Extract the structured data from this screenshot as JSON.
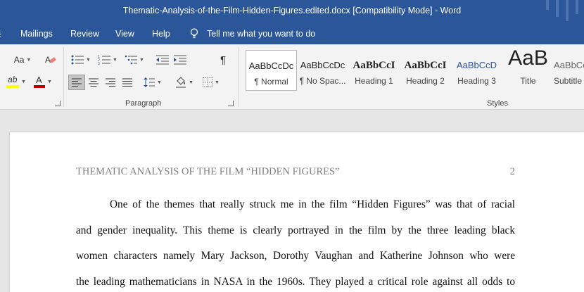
{
  "window": {
    "title": "Thematic-Analysis-of-the-Film-Hidden-Figures.edited.docx [Compatibility Mode]  -  Word"
  },
  "tabs": [
    "Mailings",
    "Review",
    "View",
    "Help"
  ],
  "tell_me": "Tell me what you want to do",
  "ribbon": {
    "font_group": {
      "change_case_label": "Aa",
      "clear_format_icon": "eraser-icon",
      "highlight_label": "ab",
      "font_color_label": "A",
      "highlight_color": "#ffff00",
      "font_color": "#c00000"
    },
    "paragraph_group": {
      "label": "Paragraph",
      "show_marks_label": "¶"
    },
    "styles_group": {
      "label": "Styles",
      "items": [
        {
          "sample": "AaBbCcDc",
          "name": "¶ Normal"
        },
        {
          "sample": "AaBbCcDc",
          "name": "¶ No Spac..."
        },
        {
          "sample": "AaBbCcI",
          "name": "Heading 1"
        },
        {
          "sample": "AaBbCcI",
          "name": "Heading 2"
        },
        {
          "sample": "AaBbCcD",
          "name": "Heading 3"
        },
        {
          "sample": "AaB",
          "name": "Title"
        },
        {
          "sample": "AaBbCcI",
          "name": "Subtitle"
        }
      ]
    }
  },
  "document": {
    "running_head": "THEMATIC ANALYSIS OF THE FILM “HIDDEN FIGURES”",
    "page_number": "2",
    "lines": [
      "One of the themes that really struck me in the film “Hidden Figures” was that of racial",
      "and gender inequality. This theme is clearly portrayed in the film by the three leading black",
      "women characters namely Mary Jackson, Dorothy Vaughan and Katherine Johnson who were",
      "the leading mathematicians in NASA in the 1960s. They played a critical role against all odds to"
    ]
  },
  "colors": {
    "brand_blue": "#2b579a",
    "heading_blue": "#2f5496"
  }
}
